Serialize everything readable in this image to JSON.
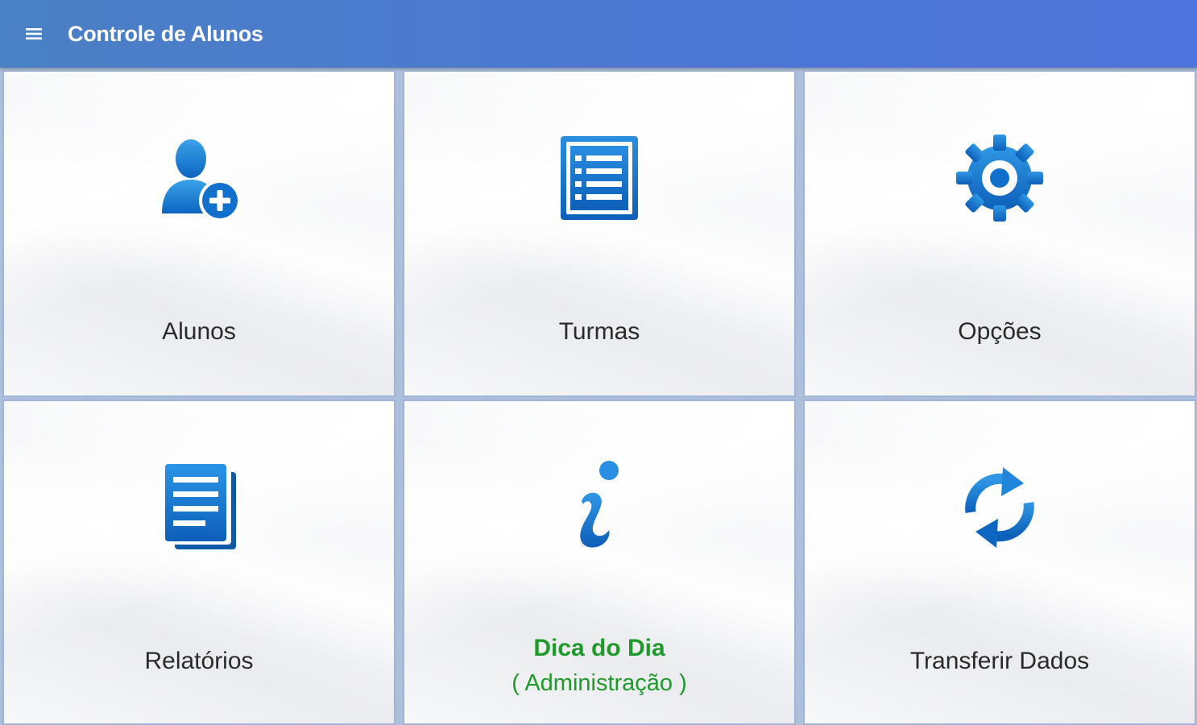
{
  "appbar": {
    "title": "Controle de Alunos",
    "menu_icon": "hamburger-menu-icon",
    "colors": {
      "from": "#4a80c4",
      "to": "#4d74da"
    }
  },
  "tiles": [
    {
      "label": "Alunos",
      "icon": "add-user-icon"
    },
    {
      "label": "Turmas",
      "icon": "list-icon"
    },
    {
      "label": "Opções",
      "icon": "gear-icon"
    },
    {
      "label": "Relatórios",
      "icon": "document-icon"
    },
    {
      "label": "Dica do Dia",
      "sublabel": "( Administração )",
      "icon": "info-icon",
      "label_color": "#1f9a2a"
    },
    {
      "label": "Transferir Dados",
      "icon": "sync-icon"
    }
  ],
  "colors": {
    "icon_blue": "#1a7fd4",
    "icon_dark": "#0d5fb0",
    "border": "#9fb4d8"
  }
}
